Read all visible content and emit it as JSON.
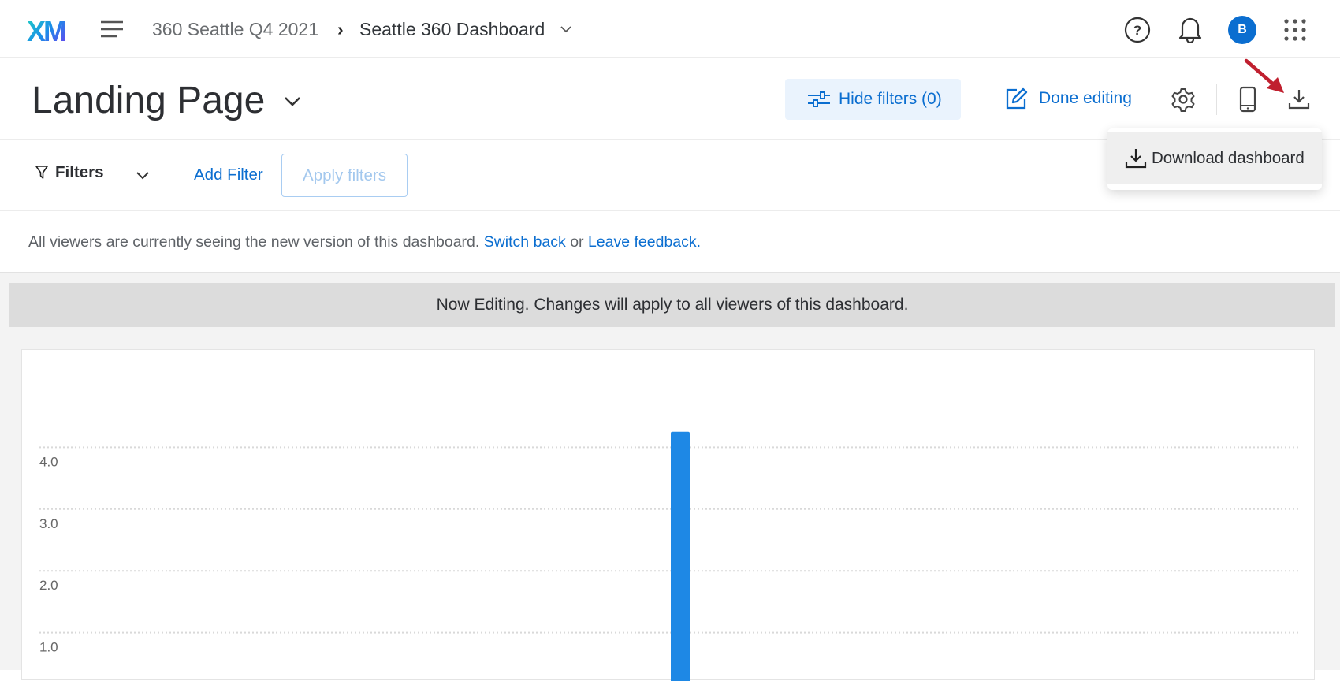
{
  "topbar": {
    "logo": "XM",
    "breadcrumb_project": "360 Seattle Q4 2021",
    "breadcrumb_separator": "›",
    "breadcrumb_dashboard": "Seattle 360 Dashboard",
    "avatar_initial": "B"
  },
  "header": {
    "page_title": "Landing Page",
    "hide_filters": "Hide filters (0)",
    "done_editing": "Done editing"
  },
  "filters": {
    "label": "Filters",
    "add_filter": "Add Filter",
    "apply_filters": "Apply filters"
  },
  "notice": {
    "text": "All viewers are currently seeing the new version of this dashboard.",
    "switch_back": "Switch back",
    "or": "or",
    "leave_feedback": "Leave feedback."
  },
  "banner": {
    "text": "Now Editing. Changes will apply to all viewers of this dashboard."
  },
  "download_menu": {
    "item": "Download dashboard"
  },
  "colors": {
    "accent": "#0b6ed0",
    "bar": "#1e88e5",
    "annotation_arrow": "#c0202f"
  },
  "chart_data": {
    "type": "bar",
    "categories": [
      ""
    ],
    "values": [
      4.25
    ],
    "yticks": [
      "1.0",
      "2.0",
      "3.0",
      "4.0"
    ],
    "ylim": [
      0,
      4.5
    ],
    "grid": true,
    "title": "",
    "xlabel": "",
    "ylabel": ""
  }
}
